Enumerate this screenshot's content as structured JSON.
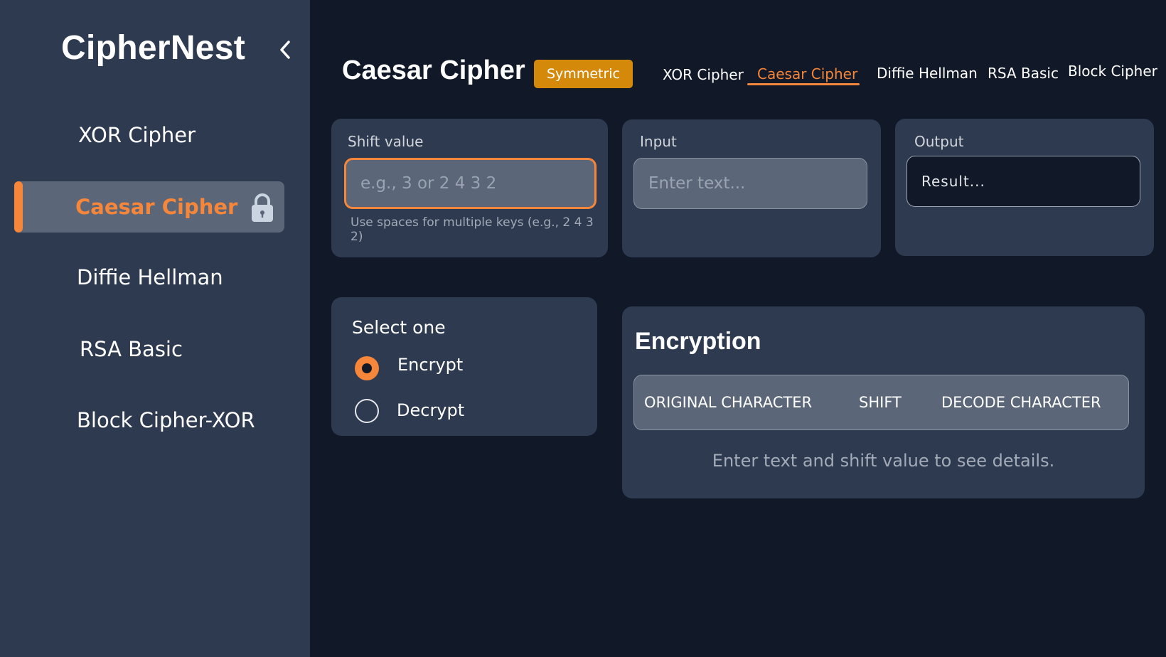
{
  "app": {
    "name": "CipherNest"
  },
  "sidebar": {
    "items": [
      {
        "label": "XOR Cipher"
      },
      {
        "label": "Caesar Cipher",
        "active": true,
        "locked": true
      },
      {
        "label": "Diffie Hellman"
      },
      {
        "label": "RSA Basic"
      },
      {
        "label": "Block Cipher-XOR"
      }
    ]
  },
  "header": {
    "title": "Caesar Cipher",
    "badge": "Symmetric",
    "tabs": [
      {
        "label": "XOR Cipher"
      },
      {
        "label": "Caesar Cipher",
        "active": true
      },
      {
        "label": "Diffie Hellman"
      },
      {
        "label": "RSA Basic"
      },
      {
        "label": "Block Cipher"
      }
    ]
  },
  "shift": {
    "label": "Shift value",
    "value": "",
    "placeholder": "e.g., 3 or 2 4 3 2",
    "hint": "Use spaces for multiple keys (e.g., 2 4 3 2)"
  },
  "input": {
    "label": "Input",
    "value": "",
    "placeholder": "Enter text..."
  },
  "output": {
    "label": "Output",
    "value": "Result..."
  },
  "mode": {
    "title": "Select one",
    "options": [
      {
        "label": "Encrypt",
        "selected": true
      },
      {
        "label": "Decrypt",
        "selected": false
      }
    ]
  },
  "encryption": {
    "title": "Encryption",
    "columns": [
      "ORIGINAL CHARACTER",
      "SHIFT",
      "DECODE CHARACTER"
    ],
    "empty_message": "Enter text and shift value to see details."
  },
  "colors": {
    "accent": "#f5863a",
    "badge": "#d4890b",
    "background": "#111827",
    "panel": "#2d3a4f"
  },
  "icons": {
    "collapse": "chevron-left-icon",
    "locked": "lock-icon"
  }
}
